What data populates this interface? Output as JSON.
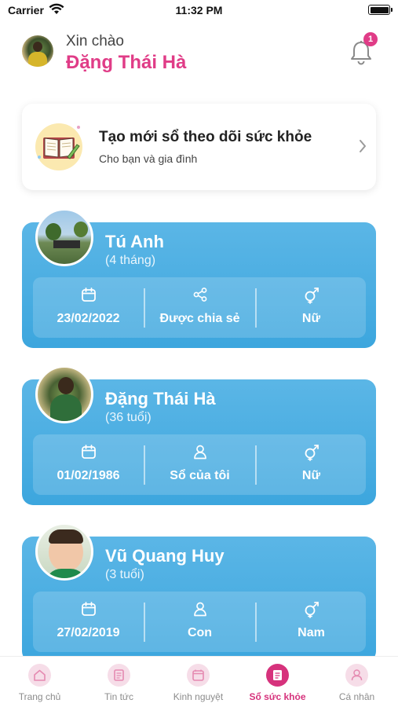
{
  "status_bar": {
    "carrier": "Carrier",
    "time": "11:32 PM"
  },
  "header": {
    "greeting": "Xin chào",
    "user_name": "Đặng Thái Hà",
    "notification_count": "1"
  },
  "create_card": {
    "title": "Tạo mới sổ theo dõi sức khỏe",
    "subtitle": "Cho bạn và gia đình"
  },
  "profiles": [
    {
      "name": "Tú Anh",
      "age": "(4 tháng)",
      "birthdate": "23/02/2022",
      "relation": "Được chia sẻ",
      "relation_icon": "share-icon",
      "gender": "Nữ"
    },
    {
      "name": "Đặng Thái Hà",
      "age": "(36 tuổi)",
      "birthdate": "01/02/1986",
      "relation": "Sổ của tôi",
      "relation_icon": "person-icon",
      "gender": "Nữ"
    },
    {
      "name": "Vũ Quang Huy",
      "age": "(3 tuổi)",
      "birthdate": "27/02/2019",
      "relation": "Con",
      "relation_icon": "person-icon",
      "gender": "Nam"
    }
  ],
  "tab_bar": {
    "active": "so-suc-khoe",
    "tabs": [
      {
        "label": "Trang chủ",
        "icon": "home-icon"
      },
      {
        "label": "Tin tức",
        "icon": "news-icon"
      },
      {
        "label": "Kinh nguyệt",
        "icon": "calendar-icon"
      },
      {
        "label": "Sổ sức khỏe",
        "icon": "health-book-icon"
      },
      {
        "label": "Cá nhân",
        "icon": "profile-icon"
      }
    ]
  },
  "colors": {
    "accent": "#e03c87",
    "card_blue": "#4cb0e3"
  }
}
